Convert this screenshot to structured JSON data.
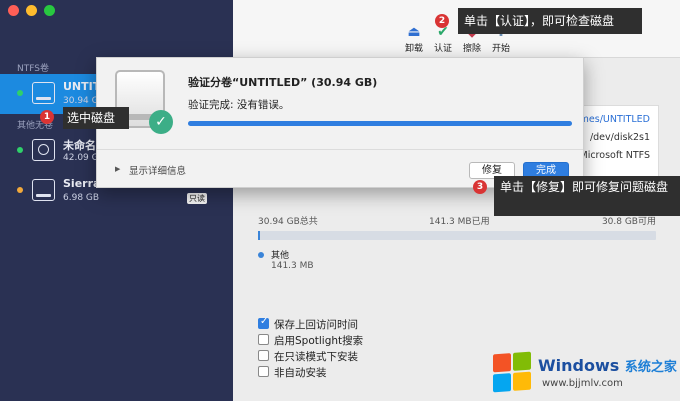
{
  "sidebar": {
    "section_ntfs": "NTFS卷",
    "section_other": "其他无卷",
    "items": [
      {
        "name": "UNTITLED",
        "size": "30.94 GB",
        "status_color": "#2fd06a",
        "badge": ""
      },
      {
        "name": "未命名",
        "size": "42.09 GB",
        "status_color": "#2fd06a",
        "badge": ""
      },
      {
        "name": "Sierra",
        "size": "6.98 GB",
        "status_color": "#f2a93b",
        "badge": "只读"
      }
    ]
  },
  "toolbar": {
    "unmount": "卸载",
    "verify": "认证",
    "erase": "擦除",
    "start": "开始"
  },
  "info": {
    "mount_path": "umes/UNTITLED",
    "device": "/dev/disk2s1",
    "filesystem": "Microsoft NTFS"
  },
  "usage": {
    "total": "30.94 GB总共",
    "used": "141.3 MB已用",
    "available": "30.8 GB可用",
    "used_fraction": 0.005,
    "legend_name": "其他",
    "legend_value": "141.3 MB"
  },
  "options": [
    {
      "label": "保存上回访问时间",
      "checked": true
    },
    {
      "label": "启用Spotlight搜索",
      "checked": false
    },
    {
      "label": "在只读模式下安装",
      "checked": false
    },
    {
      "label": "非自动安装",
      "checked": false
    }
  ],
  "dialog": {
    "title": "验证分卷“UNTITLED” (30.94 GB)",
    "status": "验证完成: 没有错误。",
    "progress": 1.0,
    "details_label": "显示详细信息",
    "repair_button": "修复",
    "done_button": "完成"
  },
  "annotations": {
    "step1_num": "1",
    "step1_text": "选中磁盘",
    "step2_num": "2",
    "step2_text": "单击【认证】，即可检查磁盘",
    "step3_num": "3",
    "step3_text": "单击【修复】即可修复问题磁盘"
  },
  "watermark": {
    "title": "Windows",
    "subtitle": "系统之家",
    "url": "www.bjjmlv.com"
  },
  "colors": {
    "sidebar_bg": "#2a3153",
    "active": "#1c8ae0",
    "accent": "#2f7ee0",
    "check_green": "#3cae87",
    "badge_red": "#d93434"
  }
}
